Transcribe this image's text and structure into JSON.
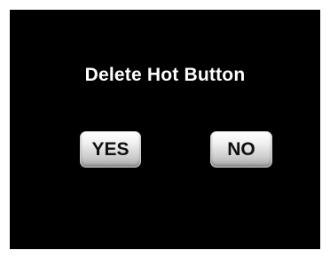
{
  "dialog": {
    "title": "Delete Hot Button",
    "yes_label": "YES",
    "no_label": "NO"
  },
  "colors": {
    "screen_background": "#000000",
    "title_text": "#ffffff",
    "button_text": "#111111"
  }
}
